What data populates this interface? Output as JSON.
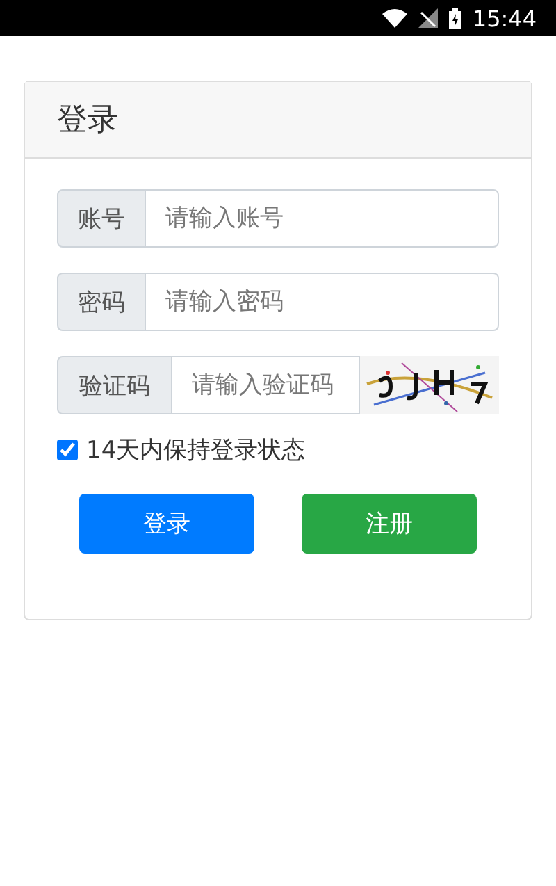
{
  "status_bar": {
    "time": "15:44"
  },
  "login_card": {
    "title": "登录",
    "fields": [
      {
        "label": "账号",
        "placeholder": "请输入账号",
        "kind": "text"
      },
      {
        "label": "密码",
        "placeholder": "请输入密码",
        "kind": "password"
      },
      {
        "label": "验证码",
        "placeholder": "请输入验证码",
        "kind": "captcha"
      }
    ],
    "remember": {
      "label": "14天内保持登录状态",
      "checked": true
    },
    "buttons": [
      {
        "label": "登录",
        "kind": "primary"
      },
      {
        "label": "注册",
        "kind": "success"
      }
    ]
  }
}
